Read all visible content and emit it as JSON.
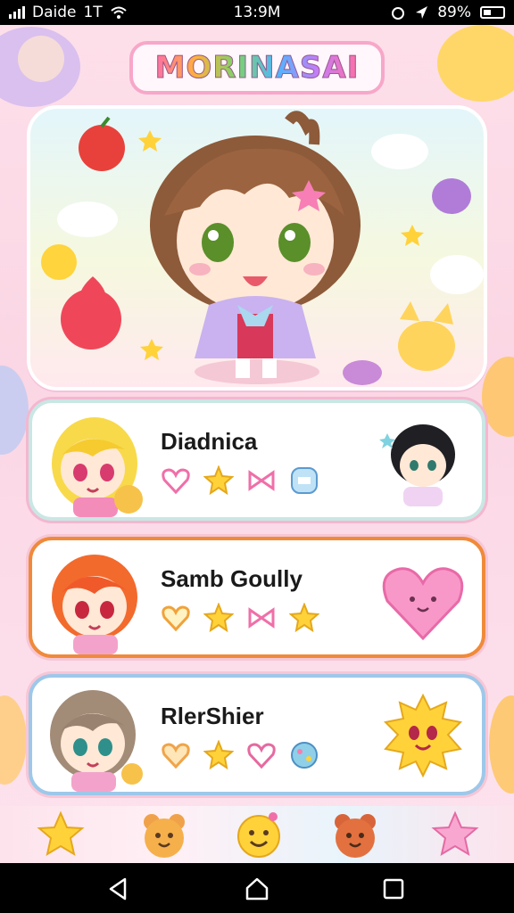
{
  "status_bar": {
    "carrier": "Daide",
    "network": "1T",
    "time": "13:9M",
    "battery_text": "89%"
  },
  "app": {
    "title": "MORINASAI"
  },
  "cards": [
    {
      "name": "Diadnica",
      "border_color": "#c9e7e4"
    },
    {
      "name": "Samb Goully",
      "border_color": "#f08a3a"
    },
    {
      "name": "RlerShier",
      "border_color": "#9dc8ea"
    }
  ],
  "bottom_nav": {
    "items": [
      "star-icon",
      "bear-icon",
      "smiley-icon",
      "bear-icon",
      "star-icon"
    ]
  },
  "system_nav": [
    "back-icon",
    "home-icon",
    "recents-icon"
  ],
  "colors": {
    "accent": "#f7a7c9",
    "background": "#fde0ea"
  }
}
